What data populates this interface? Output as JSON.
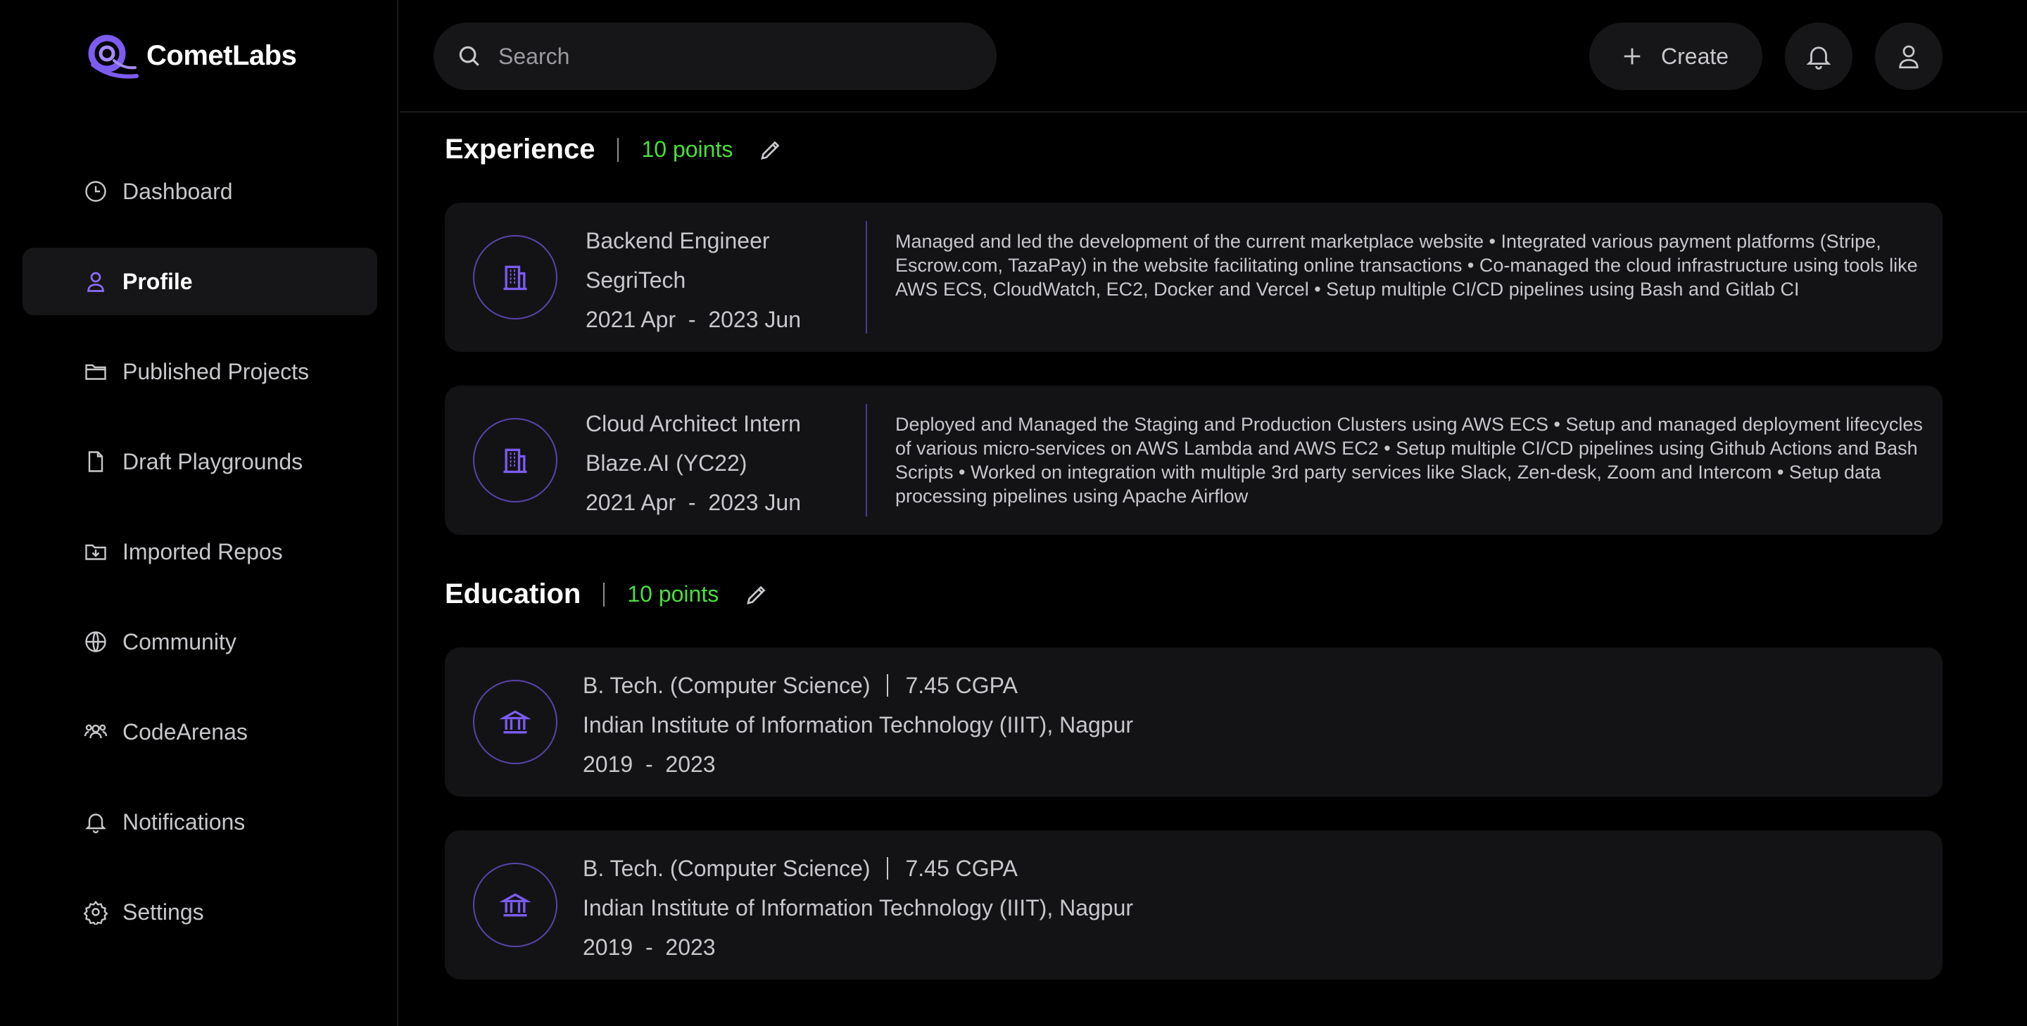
{
  "app": {
    "brand": "CometLabs",
    "accent": "#7c5cf0",
    "points_color": "#4ade3b"
  },
  "sidebar": {
    "items": [
      {
        "label": "Dashboard",
        "icon": "clock-icon",
        "active": false
      },
      {
        "label": "Profile",
        "icon": "user-icon",
        "active": true
      },
      {
        "label": "Published Projects",
        "icon": "folder-icon",
        "active": false
      },
      {
        "label": "Draft Playgrounds",
        "icon": "file-icon",
        "active": false
      },
      {
        "label": "Imported Repos",
        "icon": "folder-download-icon",
        "active": false
      },
      {
        "label": "Community",
        "icon": "globe-icon",
        "active": false
      },
      {
        "label": "CodeArenas",
        "icon": "users-icon",
        "active": false
      },
      {
        "label": "Notifications",
        "icon": "bell-icon",
        "active": false
      },
      {
        "label": "Settings",
        "icon": "gear-icon",
        "active": false
      }
    ]
  },
  "topbar": {
    "search_placeholder": "Search",
    "create_label": "Create"
  },
  "experience": {
    "title": "Experience",
    "points": "10 points",
    "entries": [
      {
        "role": "Backend Engineer",
        "company": "SegriTech",
        "period": "2021 Apr  -  2023 Jun",
        "description": "Managed and led the development of the current marketplace website • Integrated various payment platforms (Stripe, Escrow.com, TazaPay) in the website facilitating online transactions • Co-managed the cloud infrastructure using tools like AWS ECS, CloudWatch, EC2, Docker and Vercel • Setup multiple CI/CD pipelines using Bash and Gitlab CI"
      },
      {
        "role": "Cloud Architect Intern",
        "company": "Blaze.AI (YC22)",
        "period": "2021 Apr  -  2023 Jun",
        "description": "Deployed and Managed the Staging and Production Clusters using AWS ECS • Setup and managed deployment lifecycles of various micro-services on AWS Lambda and AWS EC2 • Setup multiple CI/CD pipelines using Github Actions and Bash Scripts • Worked on integration with multiple 3rd party services like Slack, Zen-desk, Zoom and Intercom • Setup data processing pipelines using Apache Airflow"
      }
    ]
  },
  "education": {
    "title": "Education",
    "points": "10 points",
    "entries": [
      {
        "degree": "B. Tech. (Computer Science)",
        "grade": "7.45 CGPA",
        "institute": "Indian Institute of Information Technology (IIIT), Nagpur",
        "period": "2019  -  2023"
      },
      {
        "degree": "B. Tech. (Computer Science)",
        "grade": "7.45 CGPA",
        "institute": "Indian Institute of Information Technology (IIIT), Nagpur",
        "period": "2019  -  2023"
      }
    ]
  }
}
